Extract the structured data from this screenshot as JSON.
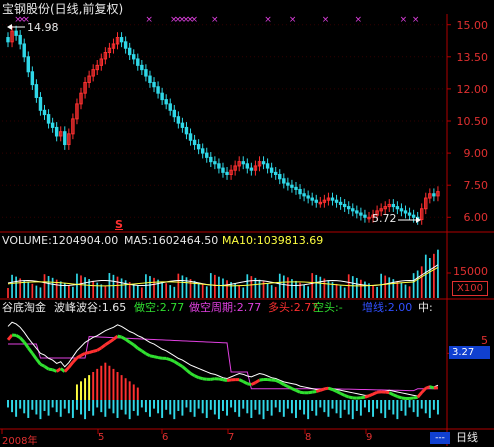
{
  "header": {
    "title": "宝钢股份(日线,前复权)"
  },
  "price_panel": {
    "high_mark": "14.98",
    "low_mark": "5.72",
    "signal_s": "S",
    "y_axis_ticks": [
      "15.00",
      "13.50",
      "12.00",
      "10.50",
      "9.00",
      "7.50",
      "6.00"
    ]
  },
  "volume_panel": {
    "volume_label": "VOLUME:1204904.00",
    "ma5_label": "MA5:1602464.50",
    "ma10_label": "MA10:1039813.69",
    "y_axis_tick": "15000",
    "multiplier_badge": "X100"
  },
  "indicator_panel": {
    "name": "谷底淘金",
    "wave_label": "波峰波谷:1.65",
    "short_label": "做空:2.77",
    "short_cycle_label": "做空周期:2.77",
    "long_label": "多头:2.77",
    "bear_label": "空头:-",
    "increase_label": "增线:2.00",
    "mid_label": "中:",
    "y_axis_tick": "5",
    "value_badge": "3.27"
  },
  "x_axis": {
    "labels": [
      "2008年",
      "5",
      "6",
      "7",
      "8",
      "9"
    ]
  },
  "bottom_bar": {
    "indicator_box": "---",
    "period_tab": "日线"
  },
  "colors": {
    "up": "#ff3030",
    "down": "#30d8e8",
    "yellow": "#ffff40",
    "magenta": "#e040e0",
    "green": "#30e030",
    "white": "#ffffff",
    "axis": "#b00000",
    "blue": "#3050ff"
  },
  "chart_data": {
    "type": "candlestick",
    "y_range": [
      5.5,
      15.5
    ],
    "closes": [
      14.2,
      14.7,
      14.5,
      14.1,
      13.5,
      12.8,
      12.2,
      11.6,
      11.0,
      10.8,
      10.4,
      10.2,
      9.8,
      10.0,
      9.4,
      9.9,
      10.6,
      11.3,
      11.8,
      12.3,
      12.6,
      12.9,
      13.1,
      13.4,
      13.7,
      13.9,
      14.1,
      14.4,
      14.2,
      13.9,
      13.6,
      13.4,
      13.1,
      12.9,
      12.6,
      12.3,
      12.1,
      11.8,
      11.5,
      11.3,
      11.0,
      10.7,
      10.4,
      10.2,
      9.9,
      9.6,
      9.4,
      9.2,
      9.0,
      8.8,
      8.6,
      8.5,
      8.3,
      8.1,
      8.0,
      8.2,
      8.4,
      8.6,
      8.5,
      8.3,
      8.2,
      8.4,
      8.6,
      8.5,
      8.3,
      8.1,
      8.0,
      7.8,
      7.6,
      7.5,
      7.4,
      7.3,
      7.1,
      7.0,
      6.9,
      6.8,
      6.7,
      6.7,
      6.8,
      6.9,
      6.8,
      6.7,
      6.6,
      6.5,
      6.4,
      6.3,
      6.2,
      6.1,
      6.0,
      6.0,
      6.1,
      6.3,
      6.4,
      6.5,
      6.6,
      6.5,
      6.4,
      6.3,
      6.2,
      6.1,
      6.0,
      5.9,
      6.4,
      6.9,
      7.1,
      7.0,
      7.2
    ]
  }
}
